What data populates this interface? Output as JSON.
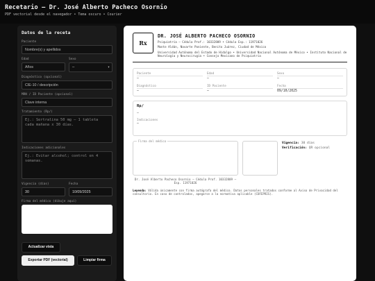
{
  "header": {
    "title": "Recetario — Dr. José Alberto Pacheco Osornio",
    "subtitle": "PDF vectorial desde el navegador • Tema oscuro • Courier"
  },
  "form": {
    "title": "Datos de la receta",
    "paciente_label": "Paciente",
    "paciente_placeholder": "Nombre(s) y apellidos",
    "edad_label": "Edad",
    "edad_placeholder": "Años",
    "sexo_label": "Sexo",
    "sexo_value": "—",
    "dx_label": "Diagnóstico (opcional)",
    "dx_placeholder": "CIE-10 / descripción",
    "mrn_label": "MRN / ID Paciente (opcional)",
    "mrn_placeholder": "Clave interna",
    "tx_label": "Tratamiento (Rp/)",
    "tx_placeholder": "Ej.: Sertralina 50 mg — 1 tableta cada mañana x 30 días.",
    "ind_label": "Indicaciones adicionales",
    "ind_placeholder": "Ej.: Evitar alcohol; control en 4 semanas.",
    "vigencia_label": "Vigencia (días)",
    "vigencia_value": "30",
    "fecha_label": "Fecha",
    "fecha_value": "10/09/2025",
    "firma_label": "Firma del médico (dibuje aquí)",
    "btn_update": "Actualizar vista",
    "btn_export": "Exportar PDF (vectorial)",
    "btn_clear": "Limpiar firma"
  },
  "doc": {
    "rx": "Rx",
    "name": "DR. JOSÉ ALBERTO PACHECO OSORNIO",
    "line1": "Psiquiatría — Cédula Prof.: 10332809 • Cédula Esp.: 11971026",
    "line2": "Monte Aldán, Navarte Poniente, Benito Juárez, Ciudad de México",
    "line3": "Universidad Autónoma del Estado de Hidalgo • Universidad Nacional Autónoma de México • Instituto Nacional de Neurología y Neurocirugía • Consejo Mexicano de Psiquiatría",
    "fields": [
      {
        "k": "Paciente",
        "v": "—"
      },
      {
        "k": "Edad",
        "v": "—"
      },
      {
        "k": "Sexo",
        "v": "—"
      },
      {
        "k": "Diagnóstico",
        "v": "—"
      },
      {
        "k": "ID Paciente",
        "v": "—"
      },
      {
        "k": "Fecha",
        "v": "09/10/2025"
      }
    ],
    "rp_label": "Rp/",
    "rp_value": "—",
    "ind_label": "Indicaciones",
    "ind_value": "—",
    "sig_label": "Firma del médico",
    "vig_key": "Vigencia:",
    "vig_val": "30 días",
    "ver_key": "Verificación:",
    "ver_val": "QR opcional",
    "under_sig": "Dr. José Alberto Pacheco Osornio — Cédula Prof. 10332809 — Esp. 11971026",
    "legend_key": "Leyenda:",
    "legend_text": "Válida únicamente con firma autógrafa del médico. Datos personales tratados conforme al Aviso de Privacidad del consultorio. En caso de controlados, apegarse a la normativa aplicable (COFEPRIS)."
  }
}
